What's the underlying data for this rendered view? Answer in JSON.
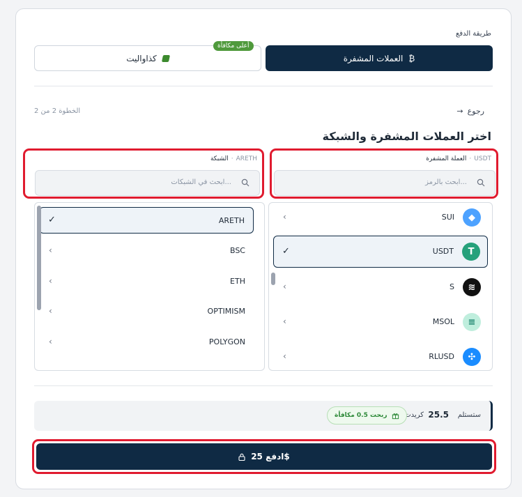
{
  "payment": {
    "title": "طريقة الدفع",
    "crypto_tab": "العملات المشفرة",
    "crypto_icon": "₿",
    "kedawallet_tab": "كذاواليت",
    "kedawallet_badge": "أعلى مكافأة"
  },
  "nav": {
    "back": "رجوع",
    "back_arrow": "→",
    "step": "الخطوة 2 من 2"
  },
  "section_title": "اختر العملات المشفرة والشبكة",
  "currency": {
    "label": "العملة المشفرة",
    "selected": "USDT",
    "placeholder": "ابحث بالرمز...",
    "items": [
      "SUI",
      "USDT",
      "S",
      "MSOL",
      "RLUSD"
    ],
    "colors": {
      "SUI": "#4da2ff",
      "USDT": "#26a17b",
      "S": "#111111",
      "MSOL": "#9fe0c8",
      "RLUSD": "#1a8cff"
    }
  },
  "network": {
    "label": "الشبكة",
    "selected": "ARETH",
    "placeholder": "ابحث في الشبكات...",
    "items": [
      "ARETH",
      "BSC",
      "ETH",
      "OPTIMISM",
      "POLYGON"
    ]
  },
  "summary": {
    "receive_label": "ستستلم",
    "amount": "25.5",
    "unit": "كريدت",
    "bonus": "ربحت 0.5 مكافأة"
  },
  "pay_button": "ادفع 25$",
  "dot": "·",
  "check": "✓",
  "chevron": "‹"
}
